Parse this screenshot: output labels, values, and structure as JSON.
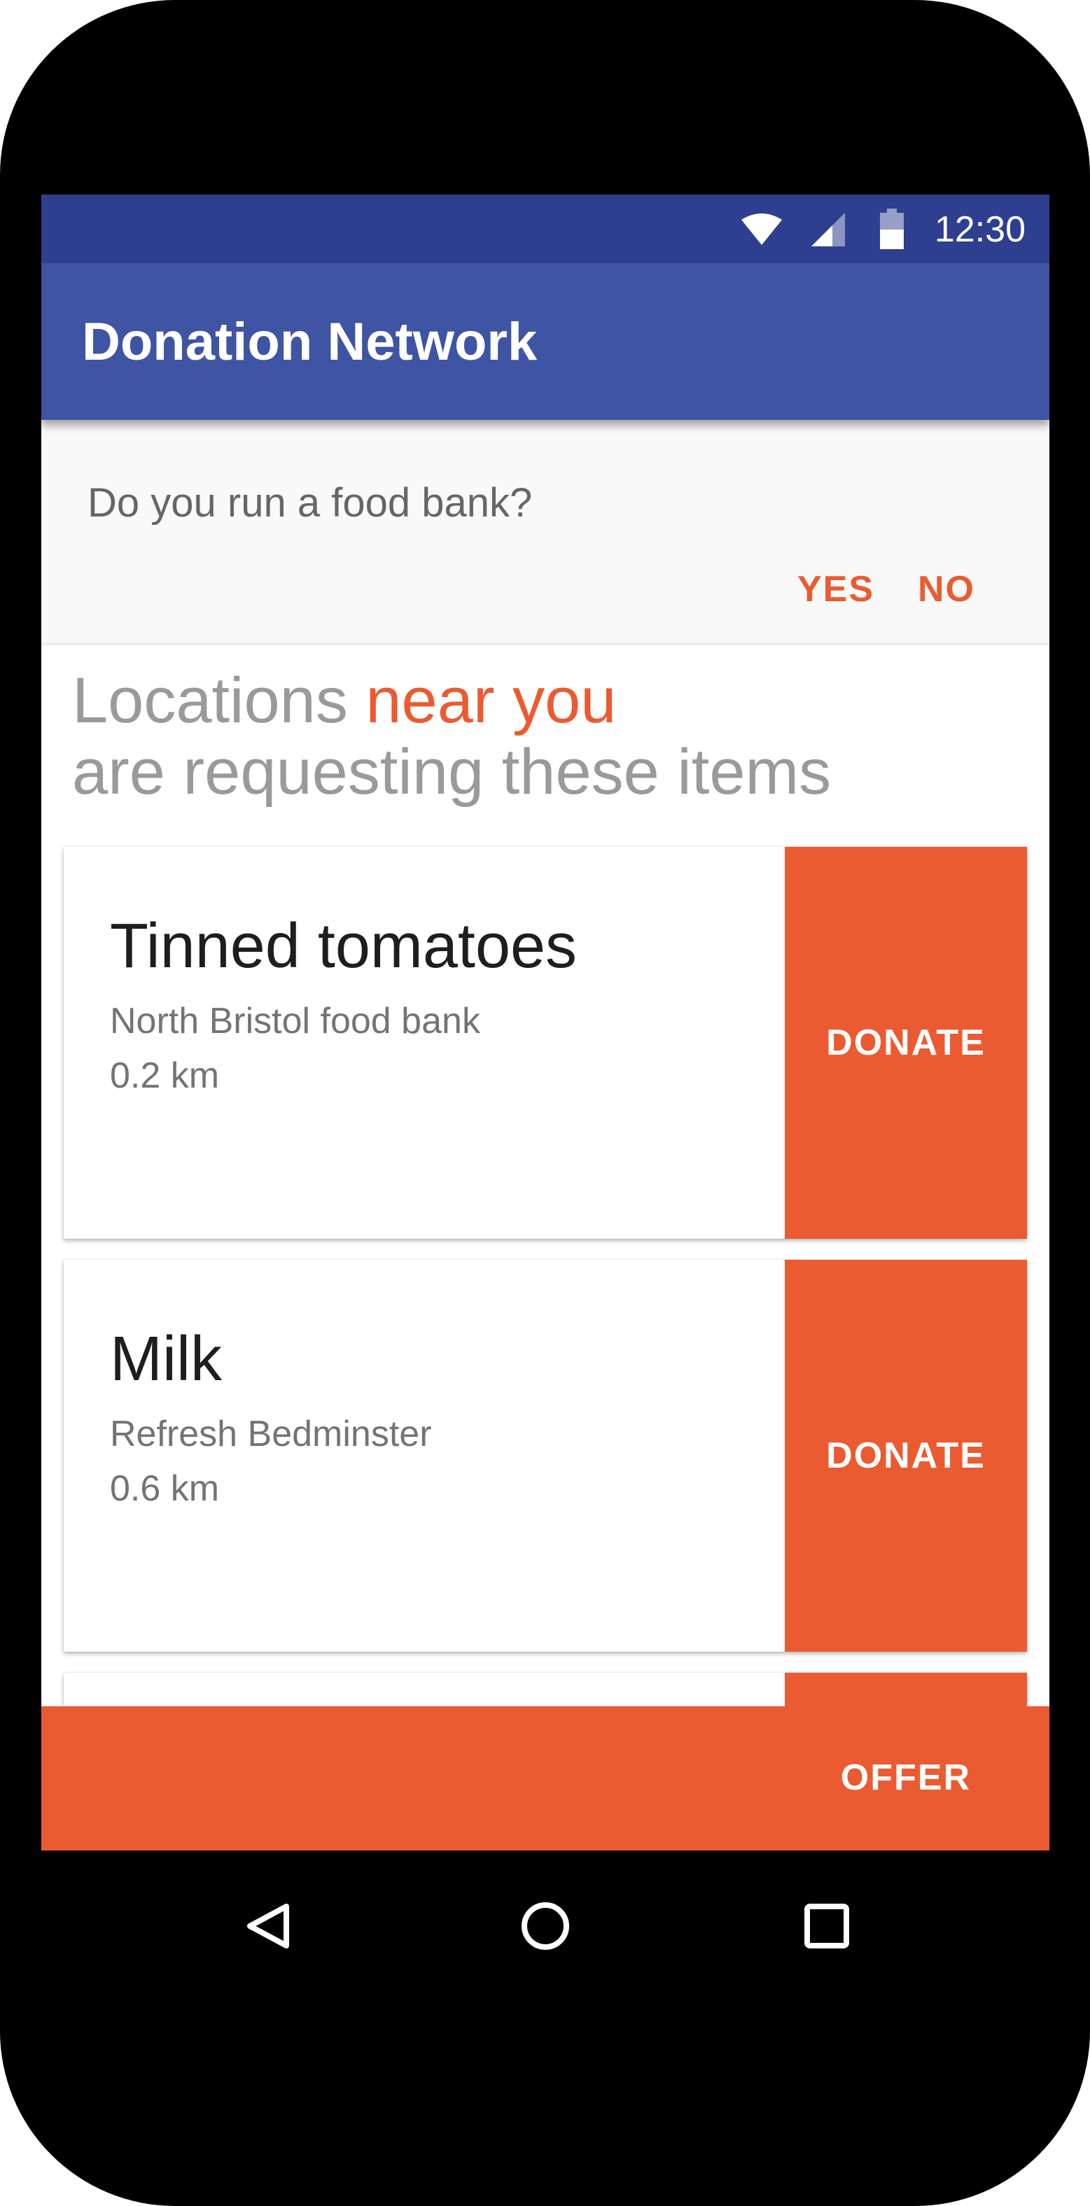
{
  "status_bar": {
    "time": "12:30",
    "icons": [
      "wifi-icon",
      "cellular-signal-icon",
      "battery-icon"
    ],
    "background_color": "#2e3f8f"
  },
  "app_bar": {
    "title": "Donation Network",
    "background_color": "#3f54a3"
  },
  "food_bank_prompt": {
    "question": "Do you run a food bank?",
    "yes_label": "YES",
    "no_label": "NO"
  },
  "headline": {
    "part1": "Locations ",
    "highlight": "near you",
    "line2": "are requesting these items"
  },
  "items": [
    {
      "title": "Tinned tomatoes",
      "location": "North Bristol food bank",
      "distance": "0.2 km",
      "action_label": "DONATE"
    },
    {
      "title": "Milk",
      "location": "Refresh Bedminster",
      "distance": "0.6 km",
      "action_label": "DONATE"
    }
  ],
  "offer_bar": {
    "label": "OFFER"
  },
  "nav_bar": {
    "buttons": [
      "back-icon",
      "home-icon",
      "recents-icon"
    ]
  },
  "colors": {
    "accent": "#eb5b31",
    "primary": "#3f54a3",
    "primary_dark": "#2e3f8f"
  }
}
